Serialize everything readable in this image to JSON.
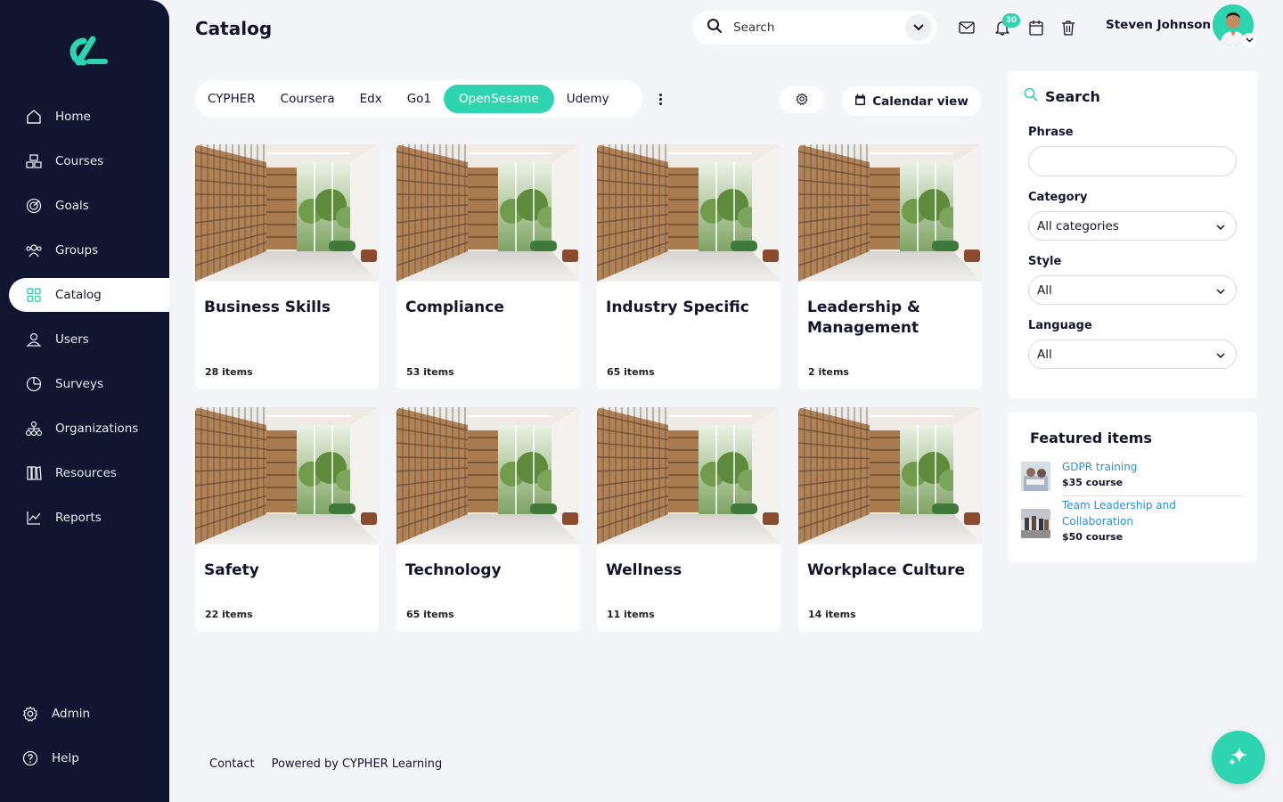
{
  "brand": {
    "accent": "#2ed3b0",
    "sidebar_bg": "#111630",
    "link": "#2a90d0"
  },
  "header": {
    "title": "Catalog",
    "search_placeholder": "Search",
    "notification_count": "30",
    "user_name": "Steven Johnson"
  },
  "sidebar": {
    "items": [
      {
        "label": "Home",
        "icon": "home-icon"
      },
      {
        "label": "Courses",
        "icon": "courses-icon"
      },
      {
        "label": "Goals",
        "icon": "goals-icon"
      },
      {
        "label": "Groups",
        "icon": "groups-icon"
      },
      {
        "label": "Catalog",
        "icon": "catalog-icon",
        "active": true
      },
      {
        "label": "Users",
        "icon": "users-icon"
      },
      {
        "label": "Surveys",
        "icon": "surveys-icon"
      },
      {
        "label": "Organizations",
        "icon": "organizations-icon"
      },
      {
        "label": "Resources",
        "icon": "resources-icon"
      },
      {
        "label": "Reports",
        "icon": "reports-icon"
      }
    ],
    "bottom": [
      {
        "label": "Admin",
        "icon": "gear-icon"
      },
      {
        "label": "Help",
        "icon": "help-icon"
      }
    ]
  },
  "tabs": [
    {
      "label": "CYPHER"
    },
    {
      "label": "Coursera"
    },
    {
      "label": "Edx"
    },
    {
      "label": "Go1"
    },
    {
      "label": "OpenSesame",
      "active": true
    },
    {
      "label": "Udemy"
    }
  ],
  "toolbar": {
    "calendar_label": "Calendar view"
  },
  "cards": [
    {
      "title": "Business Skills",
      "count": "28 items"
    },
    {
      "title": "Compliance",
      "count": "53 items"
    },
    {
      "title": "Industry Specific",
      "count": "65 items"
    },
    {
      "title": "Leadership & Management",
      "count": "2 items"
    },
    {
      "title": "Safety",
      "count": "22 items"
    },
    {
      "title": "Technology",
      "count": "65 items"
    },
    {
      "title": "Wellness",
      "count": "11 items"
    },
    {
      "title": "Workplace Culture",
      "count": "14 items"
    }
  ],
  "filter": {
    "heading": "Search",
    "phrase_label": "Phrase",
    "phrase_value": "",
    "category_label": "Category",
    "category_value": "All categories",
    "style_label": "Style",
    "style_value": "All",
    "language_label": "Language",
    "language_value": "All"
  },
  "featured": {
    "heading": "Featured items",
    "items": [
      {
        "title": "GDPR training",
        "price": "$35 course"
      },
      {
        "title": "Team Leadership and Collaboration",
        "price": "$50 course"
      }
    ]
  },
  "footer": {
    "contact": "Contact",
    "powered": "Powered by CYPHER Learning"
  }
}
